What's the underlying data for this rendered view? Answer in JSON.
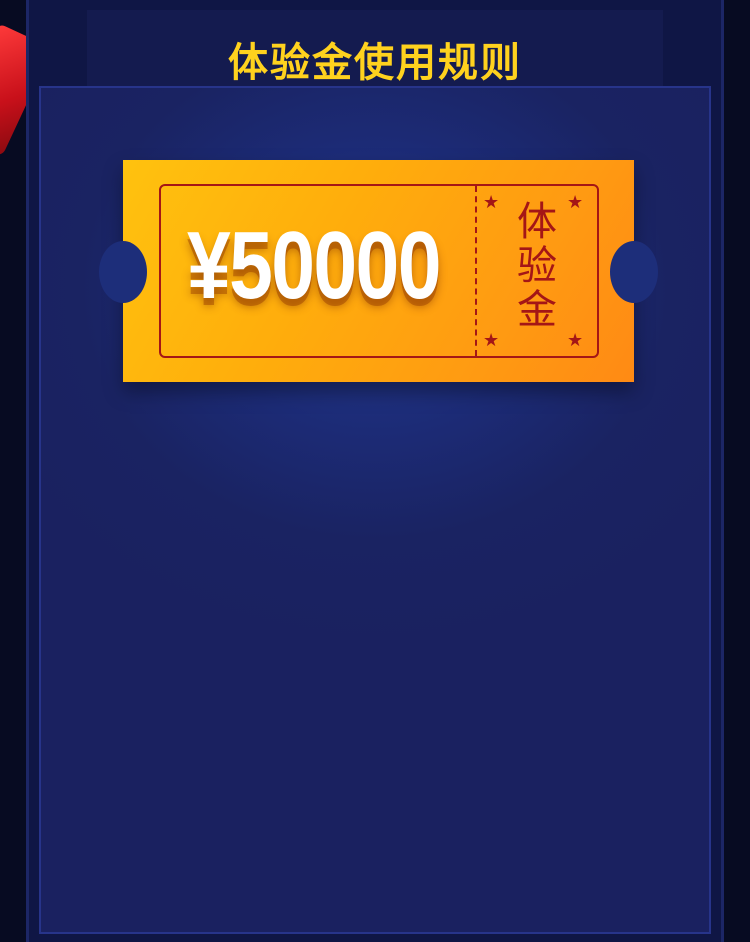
{
  "header": {
    "title": "体验金使用规则"
  },
  "voucher": {
    "amount": "¥50000",
    "label_chars": [
      "体",
      "验",
      "金"
    ]
  },
  "colors": {
    "title_gold": "#ffd21e",
    "voucher_orange": "#ffad0c",
    "voucher_red": "#a41616",
    "panel_navy": "#1c2b76"
  },
  "icons": [
    "star-icon",
    "star-icon",
    "star-icon",
    "star-icon"
  ]
}
